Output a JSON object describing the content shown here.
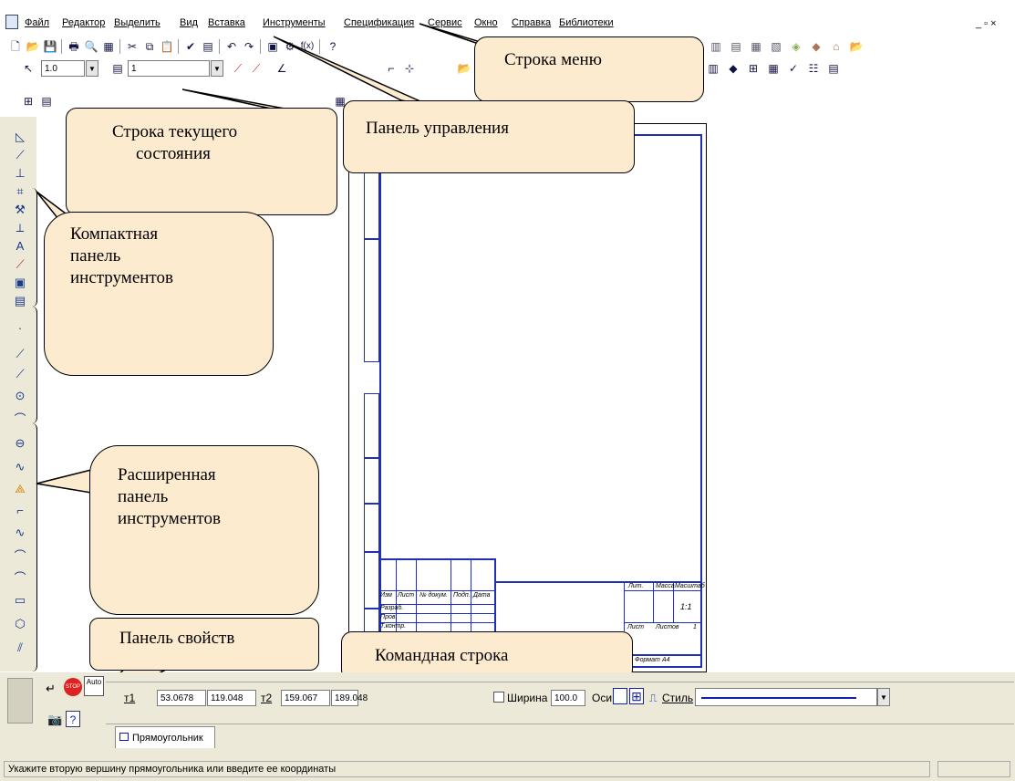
{
  "menu": {
    "items": [
      "Файл",
      "Редактор",
      "Выделить",
      "Вид",
      "Вставка",
      "Инструменты",
      "Спецификация",
      "Сервис",
      "Окно",
      "Справка",
      "Библиотеки"
    ],
    "window_controls": "_ ▫ ×"
  },
  "toolbar": {
    "line_scale": "1.0",
    "layer": "1"
  },
  "callouts": {
    "menu_bar": "Строка  меню",
    "control_panel": "Панель управления",
    "current_state_line1": "Строка  текущего",
    "current_state_line2": "состояния",
    "compact_panel_line1": "Компактная",
    "compact_panel_line2": "панель",
    "compact_panel_line3": "инструментов",
    "extended_panel_line1": "Расширенная",
    "extended_panel_line2": "панель",
    "extended_panel_line3": "инструментов",
    "properties_panel": "Панель свойств",
    "command_line": "Командная строка"
  },
  "properties": {
    "t1_label": "т1",
    "t1_x": "53.0678",
    "t1_y": "119.048",
    "t2_label": "т2",
    "t2_x": "159.067",
    "t2_y": "189.048",
    "width_label": "Ширина",
    "width_value": "100.0",
    "axes_label": "Оси",
    "style_label": "Стиль",
    "auto_label": "Auto",
    "tab_rectangle": "Прямоугольник"
  },
  "status": {
    "prompt": "Укажите вторую вершину прямоугольника или введите ее координаты"
  },
  "stamp": {
    "lit": "Лит.",
    "mass": "Масса",
    "scale": "Масштаб",
    "scale_value": "1:1",
    "sheet": "Лист",
    "sheets": "Листов",
    "sheets_value": "1",
    "izm": "Изм",
    "list": "Лист",
    "doc": "№ докум.",
    "sign": "Подп.",
    "date": "Дата",
    "razrab": "Разраб.",
    "prov": "Пров.",
    "tkontr": "Т.контр.",
    "format": "Формат",
    "format_value": "А4"
  },
  "colors": {
    "callout_fill": "#fdebcf",
    "frame_blue": "#1f2fb8",
    "panel_bg": "#ece9d8"
  }
}
